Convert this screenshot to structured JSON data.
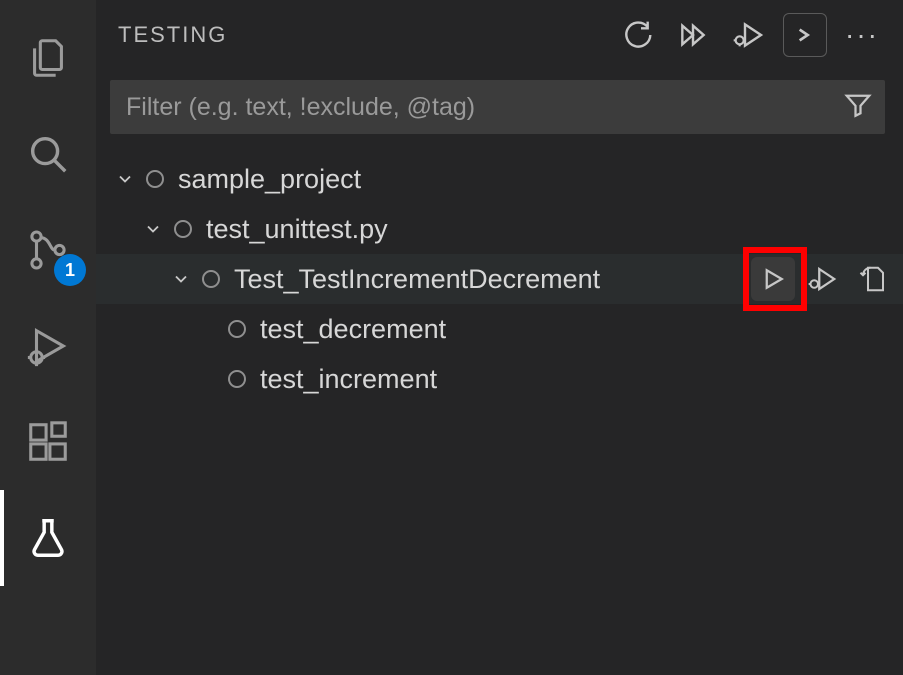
{
  "activityBar": {
    "badge": "1"
  },
  "panel": {
    "title": "TESTING"
  },
  "filter": {
    "placeholder": "Filter (e.g. text, !exclude, @tag)"
  },
  "tree": {
    "root": {
      "label": "sample_project",
      "file": {
        "label": "test_unittest.py",
        "class": {
          "label": "Test_TestIncrementDecrement",
          "test1": {
            "label": "test_decrement"
          },
          "test2": {
            "label": "test_increment"
          }
        }
      }
    }
  }
}
